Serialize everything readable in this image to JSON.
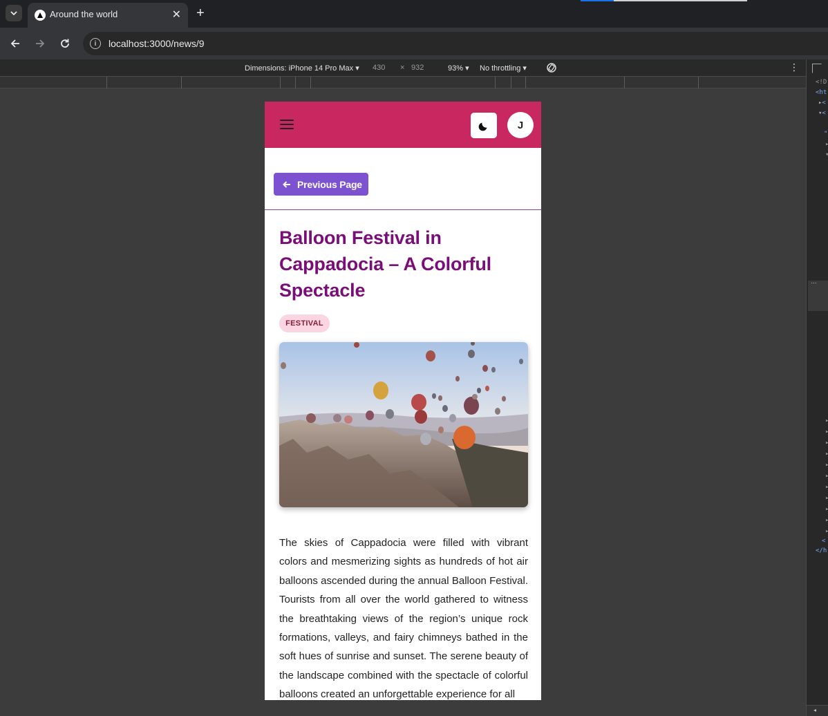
{
  "browser": {
    "tab_title": "Around the world",
    "url": "localhost:3000/news/9"
  },
  "devtools": {
    "dimensions_label": "Dimensions: iPhone 14 Pro Max",
    "width": "430",
    "times": "×",
    "height": "932",
    "zoom": "93%",
    "throttling": "No throttling",
    "panel_lines": [
      "<!D",
      "<ht",
      "<",
      "<",
      "\"",
      "<",
      "</h"
    ]
  },
  "app": {
    "avatar_initial": "J",
    "previous_button": "Previous Page",
    "title": "Balloon Festival in Cappadocia – A Colorful Spectacle",
    "tag": "FESTIVAL",
    "image_alt": "Hot air balloons over Cappadocia valley",
    "body": "The skies of Cappadocia were filled with vibrant colors and mesmerizing sights as hundreds of hot air balloons ascended during the annual Balloon Festival. Tourists from all over the world gathered to witness the breathtaking views of the region’s unique rock formations, valleys, and fairy chimneys bathed in the soft hues of sunrise and sunset. The serene beauty of the landscape combined with the spectacle of colorful balloons created an unforgettable experience for all"
  },
  "colors": {
    "header": "#c8285f",
    "button": "#7c52d1",
    "title": "#7a0e78",
    "badge_bg": "#fbd5e1"
  }
}
